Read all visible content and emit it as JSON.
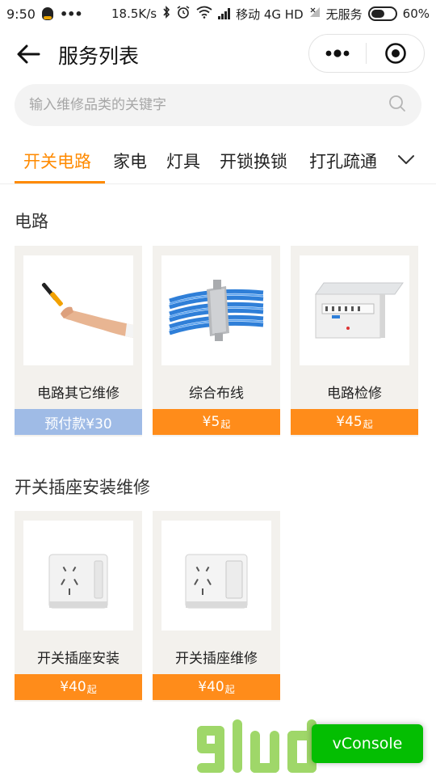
{
  "status_bar": {
    "time": "9:50",
    "speed": "18.5K/s",
    "carrier": "移动 4G HD",
    "no_service": "无服务",
    "battery": "60%",
    "battery_level": 0.6
  },
  "nav": {
    "title": "服务列表"
  },
  "search": {
    "placeholder": "输入维修品类的关键字"
  },
  "tabs": {
    "items": [
      "开关电路",
      "家电",
      "灯具",
      "开锁换锁",
      "打孔疏通"
    ],
    "active": "开关电路"
  },
  "sections": [
    {
      "title": "电路",
      "cards": [
        {
          "name": "电路其它维修",
          "price": "预付款¥30",
          "suffix": "",
          "image": "electrician-hand-tool-icon"
        },
        {
          "name": "综合布线",
          "price": "¥5",
          "suffix": "起",
          "image": "cable-bundle-icon"
        },
        {
          "name": "电路检修",
          "price": "¥45",
          "suffix": "起",
          "image": "distribution-box-icon"
        }
      ]
    },
    {
      "title": "开关插座安装维修",
      "cards": [
        {
          "name": "开关插座安装",
          "price": "¥40",
          "suffix": "起",
          "image": "wall-socket-icon"
        },
        {
          "name": "开关插座维修",
          "price": "¥40",
          "suffix": "起",
          "image": "wall-socket-switch-icon"
        }
      ]
    }
  ],
  "vconsole": {
    "label": "vConsole"
  },
  "colors": {
    "accent": "#ff8a00",
    "price_bg": "#ff8c1a",
    "prepay_bg": "#9fbbe6",
    "vconsole_bg": "#04be02"
  }
}
